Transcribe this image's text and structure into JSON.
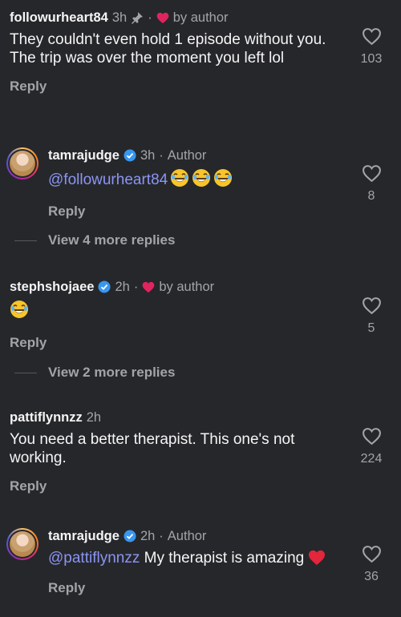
{
  "colors": {
    "background": "#26272b",
    "mention": "#8b95f2",
    "heart": "#e0245e",
    "verified": "#3897f0",
    "muted": "#a3a4a8"
  },
  "comments": [
    {
      "username": "followurheart84",
      "time": "3h",
      "pinned": true,
      "liked_by_author_label": "by author",
      "text": "They couldn't even hold 1 episode without you. The trip was over the moment you left lol",
      "reply_label": "Reply",
      "likes": "103"
    },
    {
      "username": "tamrajudge",
      "verified": true,
      "time": "3h",
      "role_label": "Author",
      "mention": "@followurheart84",
      "emojis": [
        "laughing-face-icon",
        "laughing-face-icon",
        "laughing-face-icon"
      ],
      "reply_label": "Reply",
      "likes": "8"
    },
    {
      "username": "stephshojaee",
      "verified": true,
      "time": "2h",
      "liked_by_author_label": "by author",
      "emojis": [
        "laughing-face-icon"
      ],
      "reply_label": "Reply",
      "likes": "5"
    },
    {
      "username": "pattiflynnzz",
      "time": "2h",
      "text": "You need a better therapist. This one's not working.",
      "reply_label": "Reply",
      "likes": "224"
    },
    {
      "username": "tamrajudge",
      "verified": true,
      "time": "2h",
      "role_label": "Author",
      "mention": "@pattiflynnzz",
      "text": " My therapist is amazing",
      "emojis": [
        "red-heart-icon"
      ],
      "reply_label": "Reply",
      "likes": "36"
    }
  ],
  "view_more": [
    {
      "label": "View 4 more replies"
    },
    {
      "label": "View 2 more replies"
    }
  ]
}
